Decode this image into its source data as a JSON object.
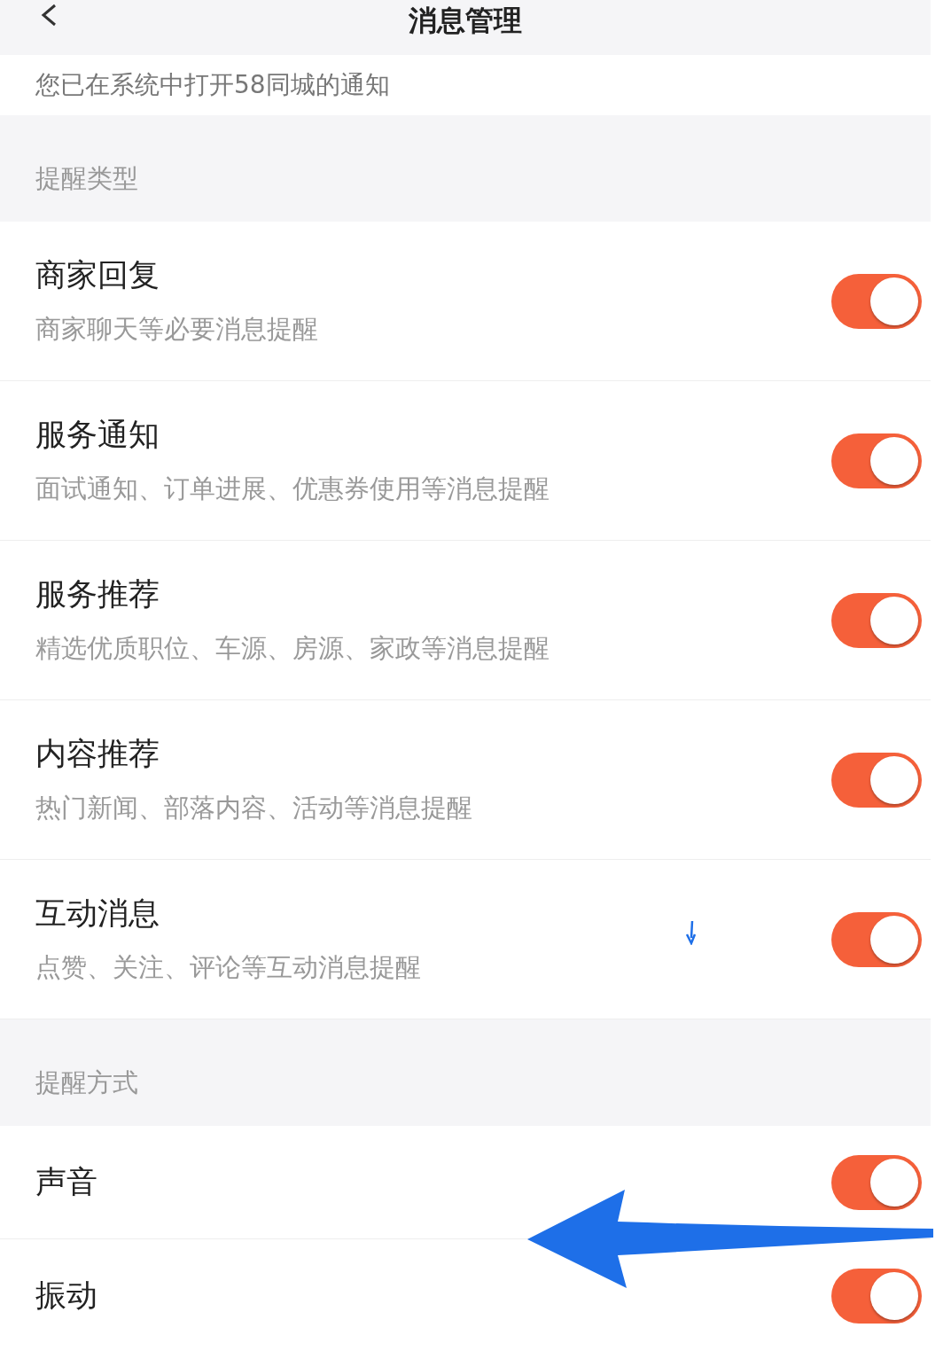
{
  "header": {
    "title": "消息管理"
  },
  "notice": "您已在系统中打开58同城的通知",
  "sections": [
    {
      "title": "提醒类型",
      "items": [
        {
          "title": "商家回复",
          "subtitle": "商家聊天等必要消息提醒",
          "on": true
        },
        {
          "title": "服务通知",
          "subtitle": "面试通知、订单进展、优惠券使用等消息提醒",
          "on": true
        },
        {
          "title": "服务推荐",
          "subtitle": "精选优质职位、车源、房源、家政等消息提醒",
          "on": true
        },
        {
          "title": "内容推荐",
          "subtitle": "热门新闻、部落内容、活动等消息提醒",
          "on": true
        },
        {
          "title": "互动消息",
          "subtitle": "点赞、关注、评论等互动消息提醒",
          "on": true
        }
      ]
    },
    {
      "title": "提醒方式",
      "items": [
        {
          "title": "声音",
          "on": true
        },
        {
          "title": "振动",
          "on": true
        }
      ]
    }
  ]
}
